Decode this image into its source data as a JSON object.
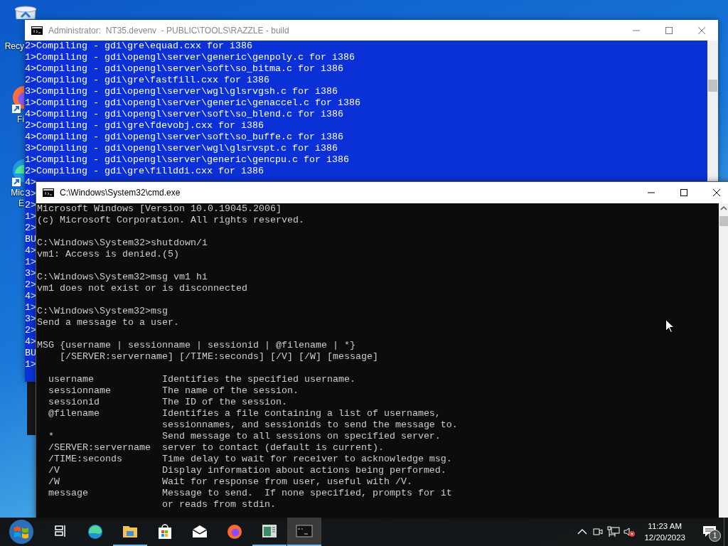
{
  "desktop_icons": [
    {
      "kind": "recycle",
      "label_lines": [
        "Recy"
      ]
    },
    {
      "kind": "firefox",
      "label_lines": [
        "Fi"
      ]
    },
    {
      "kind": "edge",
      "label_lines": [
        "Mic",
        "E"
      ]
    }
  ],
  "back_window": {
    "title": "Administrator:  NT35.devenv  - PUBLIC\\TOOLS\\RAZZLE - build",
    "active": false,
    "lines": [
      "2>Compiling - gdi\\gre\\equad.cxx for i386",
      "1>Compiling - gdi\\opengl\\server\\generic\\genpoly.c for i386",
      "4>Compiling - gdi\\opengl\\server\\soft\\so_bitma.c for i386",
      "2>Compiling - gdi\\gre\\fastfill.cxx for i386",
      "3>Compiling - gdi\\opengl\\server\\wgl\\glsrvgsh.c for i386",
      "1>Compiling - gdi\\opengl\\server\\generic\\genaccel.c for i386",
      "4>Compiling - gdi\\opengl\\server\\soft\\so_blend.c for i386",
      "2>Compiling - gdi\\gre\\fdevobj.cxx for i386",
      "4>Compiling - gdi\\opengl\\server\\soft\\so_buffe.c for i386",
      "3>Compiling - gdi\\opengl\\server\\wgl\\glsrvspt.c for i386",
      "1>Compiling - gdi\\opengl\\server\\generic\\gencpu.c for i386",
      "2>Compiling - gdi\\gre\\fillddi.cxx for i386",
      "4>",
      "3>",
      "2>",
      "1>",
      "2>",
      "BU",
      "4>",
      "1>",
      "3>",
      "2>",
      "4>",
      "1>",
      "3>",
      "2>",
      "4>",
      "BU",
      "1>"
    ]
  },
  "front_window": {
    "title": "C:\\Windows\\System32\\cmd.exe",
    "active": true,
    "blocks": [
      [
        "Microsoft Windows [Version 10.0.19045.2006]",
        "(c) Microsoft Corporation. All rights reserved."
      ],
      [
        "C:\\Windows\\System32>shutdown/i",
        "vm1: Access is denied.(5)"
      ],
      [
        "C:\\Windows\\System32>msg vm1 hi",
        "vm1 does not exist or is disconnected"
      ],
      [
        "C:\\Windows\\System32>msg",
        "Send a message to a user."
      ],
      [
        "MSG {username | sessionname | sessionid | @filename | *}",
        "    [/SERVER:servername] [/TIME:seconds] [/V] [/W] [message]"
      ],
      [
        "  username            Identifies the specified username.",
        "  sessionname         The name of the session.",
        "  sessionid           The ID of the session.",
        "  @filename           Identifies a file containing a list of usernames,",
        "                      sessionnames, and sessionids to send the message to.",
        "  *                   Send message to all sessions on specified server.",
        "  /SERVER:servername  server to contact (default is current).",
        "  /TIME:seconds       Time delay to wait for receiver to acknowledge msg.",
        "  /V                  Display information about actions being performed.",
        "  /W                  Wait for response from user, useful with /V.",
        "  message             Message to send.  If none specified, prompts for it",
        "                      or reads from stdin."
      ]
    ]
  },
  "taskbar": {
    "apps": [
      {
        "kind": "taskview",
        "running": false,
        "selected": false
      },
      {
        "kind": "edge",
        "running": false,
        "selected": false
      },
      {
        "kind": "explorer",
        "running": true,
        "selected": false
      },
      {
        "kind": "store",
        "running": false,
        "selected": false
      },
      {
        "kind": "mail",
        "running": false,
        "selected": false
      },
      {
        "kind": "firefox",
        "running": false,
        "selected": false
      },
      {
        "kind": "app",
        "running": true,
        "selected": false
      },
      {
        "kind": "terminal",
        "running": true,
        "selected": true
      }
    ],
    "clock": {
      "time": "11:23 AM",
      "date": "12/20/2023"
    },
    "notification_count": "1"
  }
}
